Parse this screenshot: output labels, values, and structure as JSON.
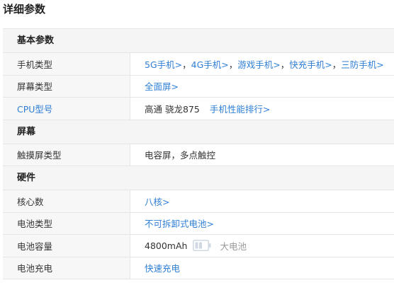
{
  "page": {
    "title": "详细参数"
  },
  "sections": {
    "basic": {
      "title": "基本参数",
      "phone_type": {
        "label": "手机类型",
        "links": [
          "5G手机>",
          "4G手机>",
          "游戏手机>",
          "快充手机>",
          "三防手机>"
        ],
        "sep": "，"
      },
      "screen_type": {
        "label": "屏幕类型",
        "link": "全面屏>"
      },
      "cpu": {
        "label": "CPU型号",
        "value": "高通 骁龙875",
        "link": "手机性能排行>"
      }
    },
    "screen": {
      "title": "屏幕",
      "touch": {
        "label": "触摸屏类型",
        "value": "电容屏，多点触控"
      }
    },
    "hardware": {
      "title": "硬件",
      "cores": {
        "label": "核心数",
        "link": "八核>"
      },
      "battery_type": {
        "label": "电池类型",
        "link": "不可拆卸式电池>"
      },
      "battery_capacity": {
        "label": "电池容量",
        "value": "4800mAh",
        "tag": "大电池",
        "icon": "battery-icon"
      },
      "charging": {
        "label": "电池充电",
        "link": "快速充电"
      }
    }
  },
  "colors": {
    "link": "#2f7fd6",
    "header_bg": "#f5f5f5",
    "border": "#e6e6e6"
  }
}
